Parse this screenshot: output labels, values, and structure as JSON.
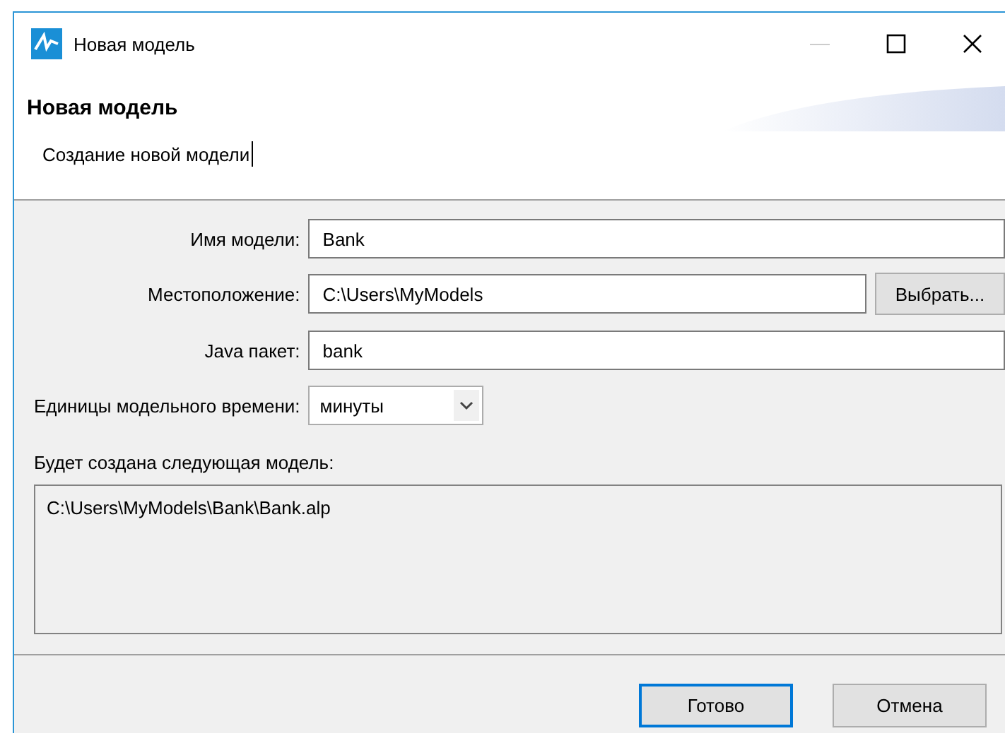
{
  "window": {
    "title": "Новая модель"
  },
  "header": {
    "title": "Новая модель",
    "description": "Создание новой модели"
  },
  "form": {
    "fields": [
      {
        "kind": "text",
        "label": "Имя модели:",
        "value": "Bank"
      },
      {
        "kind": "browse",
        "label": "Местоположение:",
        "value": "C:\\Users\\MyModels",
        "button": "Выбрать..."
      },
      {
        "kind": "text",
        "label": "Java пакет:",
        "value": "bank"
      },
      {
        "kind": "combo",
        "label": "Единицы модельного времени:",
        "value": "минуты"
      }
    ],
    "result_label": "Будет создана следующая модель:",
    "result": "C:\\Users\\MyModels\\Bank\\Bank.alp"
  },
  "buttons": [
    {
      "label": "Готово",
      "default": true
    },
    {
      "label": "Отмена",
      "default": false
    }
  ]
}
